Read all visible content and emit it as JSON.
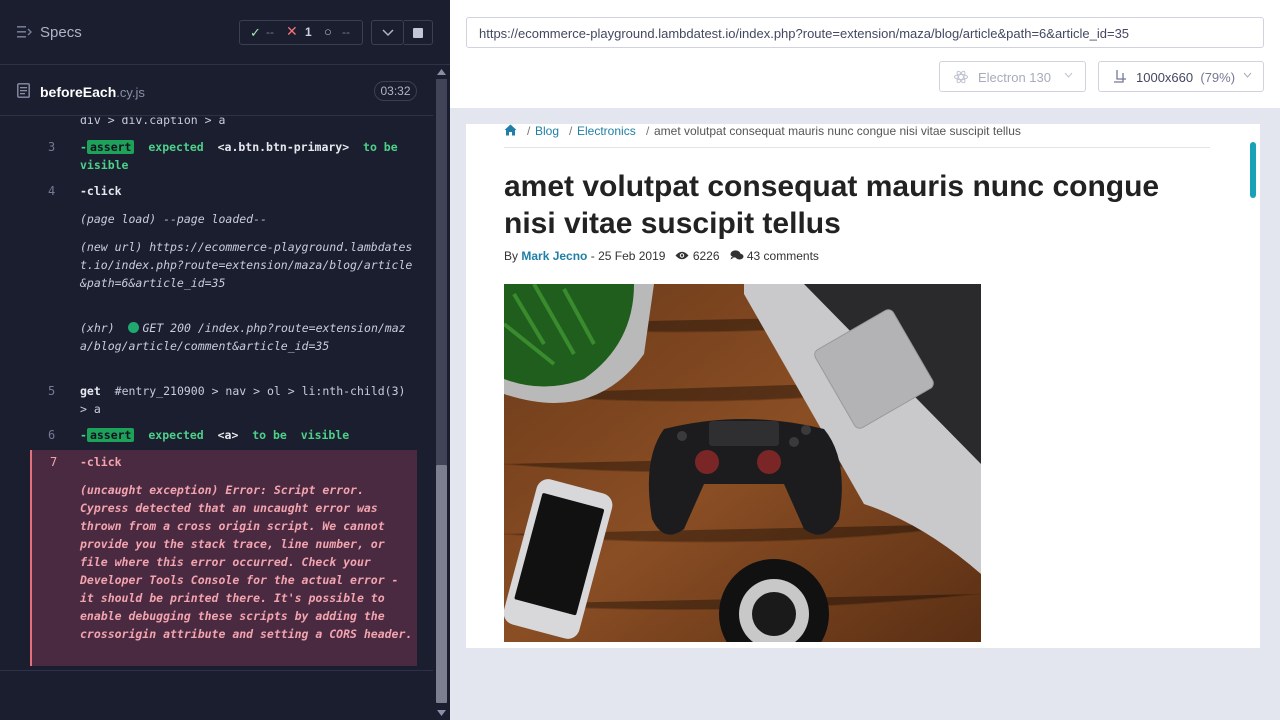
{
  "runner": {
    "specs_label": "Specs",
    "stats": {
      "passed": "--",
      "failed": "1",
      "pending": "--"
    },
    "file": {
      "name": "beforeEach",
      "ext": ".cy.js",
      "duration": "03:32"
    },
    "log": {
      "clipped_top": "div > div.caption > a",
      "entries": [
        {
          "num": "3",
          "prefix": "-",
          "badge": "assert",
          "text_a": "expected",
          "arg": "<a.btn.btn-primary>",
          "text_b": "to be",
          "text_c": "visible"
        },
        {
          "num": "4",
          "text": "-click"
        },
        {
          "page_load": "(page load)  --page loaded--"
        },
        {
          "new_url": "(new url)  https://ecommerce-playground.lambdatest.io/index.php?route=extension/maza/blog/article&path=6&article_id=35"
        },
        {
          "xhr_label": "(xhr)",
          "xhr_text": "GET 200 /index.php?route=extension/maza/blog/article/comment&article_id=35"
        },
        {
          "num": "5",
          "cmd": "get",
          "selector": "#entry_210900 > nav > ol > li:nth-child(3) > a"
        },
        {
          "num": "6",
          "prefix": "-",
          "badge": "assert",
          "text_a": "expected",
          "arg": "<a>",
          "text_b": "to be",
          "text_c": "visible"
        },
        {
          "num": "7",
          "text": "-click"
        }
      ],
      "error": "(uncaught exception)  Error: Script error. Cypress detected that an uncaught error was thrown from a cross origin script. We cannot provide you the stack trace, line number, or file where this error occurred. Check your Developer Tools Console for the actual error - it should be printed there. It's possible to enable debugging these scripts by adding the crossorigin attribute and setting a CORS header."
    }
  },
  "preview": {
    "url": "https://ecommerce-playground.lambdatest.io/index.php?route=extension/maza/blog/article&path=6&article_id=35",
    "browser": "Electron 130",
    "viewport": "1000x660",
    "zoom": "(79%)"
  },
  "article": {
    "breadcrumb": [
      "Blog",
      "Electronics",
      "amet volutpat consequat mauris nunc congue nisi vitae suscipit tellus"
    ],
    "title": "amet volutpat consequat mauris nunc congue nisi vitae suscipit tellus",
    "by": "By",
    "author": "Mark Jecno",
    "date": "- 25 Feb 2019",
    "views": "6226",
    "comments": "43 comments"
  }
}
